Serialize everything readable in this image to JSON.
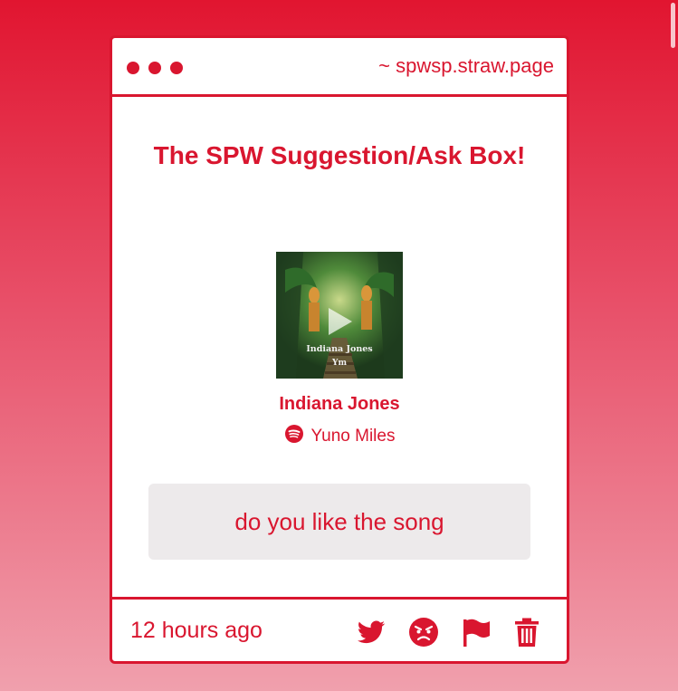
{
  "window": {
    "url": "~ spwsp.straw.page"
  },
  "page": {
    "title": "The SPW Suggestion/Ask Box!"
  },
  "song": {
    "album_text_line1": "Indiana Jones",
    "album_text_line2": "Ym",
    "title": "Indiana Jones",
    "artist": "Yuno Miles",
    "service_icon": "spotify-icon"
  },
  "question": {
    "text": "do you like the song"
  },
  "footer": {
    "timestamp": "12 hours ago",
    "actions": [
      "twitter-icon",
      "angry-face-icon",
      "flag-icon",
      "trash-icon"
    ]
  },
  "colors": {
    "accent": "#d9162f",
    "question_bg": "#edeaeb"
  }
}
